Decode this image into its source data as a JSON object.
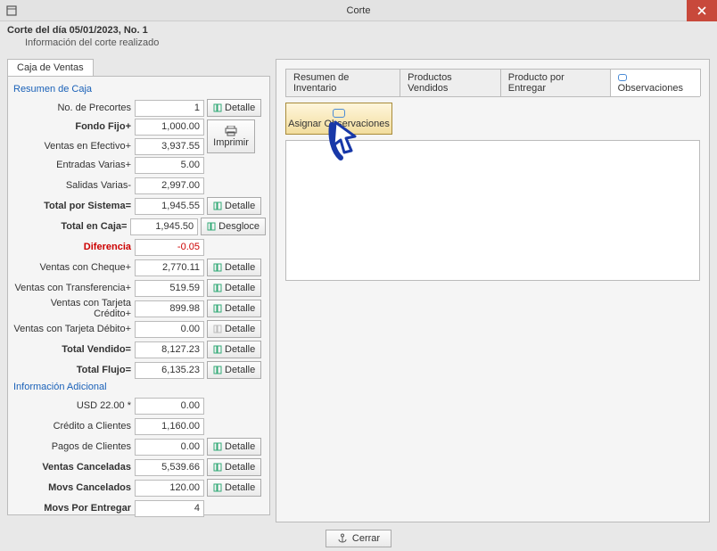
{
  "window": {
    "title": "Corte"
  },
  "header": {
    "title": "Corte del día 05/01/2023, No. 1",
    "sub": "Información del corte realizado"
  },
  "leftTab": "Caja de Ventas",
  "sections": {
    "resumen": "Resumen de Caja",
    "info": "Información Adicional"
  },
  "rows": {
    "precortes": {
      "label": "No. de Precortes",
      "value": "1"
    },
    "fondo": {
      "label": "Fondo Fijo+",
      "value": "1,000.00"
    },
    "efectivo": {
      "label": "Ventas en Efectivo+",
      "value": "3,937.55"
    },
    "entradas": {
      "label": "Entradas Varias+",
      "value": "5.00"
    },
    "salidas": {
      "label": "Salidas Varias-",
      "value": "2,997.00"
    },
    "sistema": {
      "label": "Total por Sistema=",
      "value": "1,945.55"
    },
    "caja": {
      "label": "Total en Caja=",
      "value": "1,945.50"
    },
    "dif": {
      "label": "Diferencia",
      "value": "-0.05"
    },
    "cheque": {
      "label": "Ventas con Cheque+",
      "value": "2,770.11"
    },
    "transfer": {
      "label": "Ventas con Transferencia+",
      "value": "519.59"
    },
    "credito": {
      "label": "Ventas con Tarjeta Crédito+",
      "value": "899.98"
    },
    "debito": {
      "label": "Ventas con Tarjeta Débito+",
      "value": "0.00"
    },
    "vendido": {
      "label": "Total Vendido=",
      "value": "8,127.23"
    },
    "flujo": {
      "label": "Total Flujo=",
      "value": "6,135.23"
    },
    "usd": {
      "label": "USD 22.00 *",
      "value": "0.00"
    },
    "credcli": {
      "label": "Crédito a Clientes",
      "value": "1,160.00"
    },
    "pagoscli": {
      "label": "Pagos de Clientes",
      "value": "0.00"
    },
    "cancel": {
      "label": "Ventas Canceladas",
      "value": "5,539.66"
    },
    "movcancel": {
      "label": "Movs Cancelados",
      "value": "120.00"
    },
    "entregar": {
      "label": "Movs Por Entregar",
      "value": "4"
    }
  },
  "buttons": {
    "detalle": "Detalle",
    "imprimir": "Imprimir",
    "desgloce": "Desgloce",
    "cerrar": "Cerrar",
    "asignar": "Asignar Observaciones"
  },
  "rtabs": {
    "inv": "Resumen de Inventario",
    "prod": "Productos Vendidos",
    "entregar": "Producto por Entregar",
    "obs": "Observaciones"
  }
}
